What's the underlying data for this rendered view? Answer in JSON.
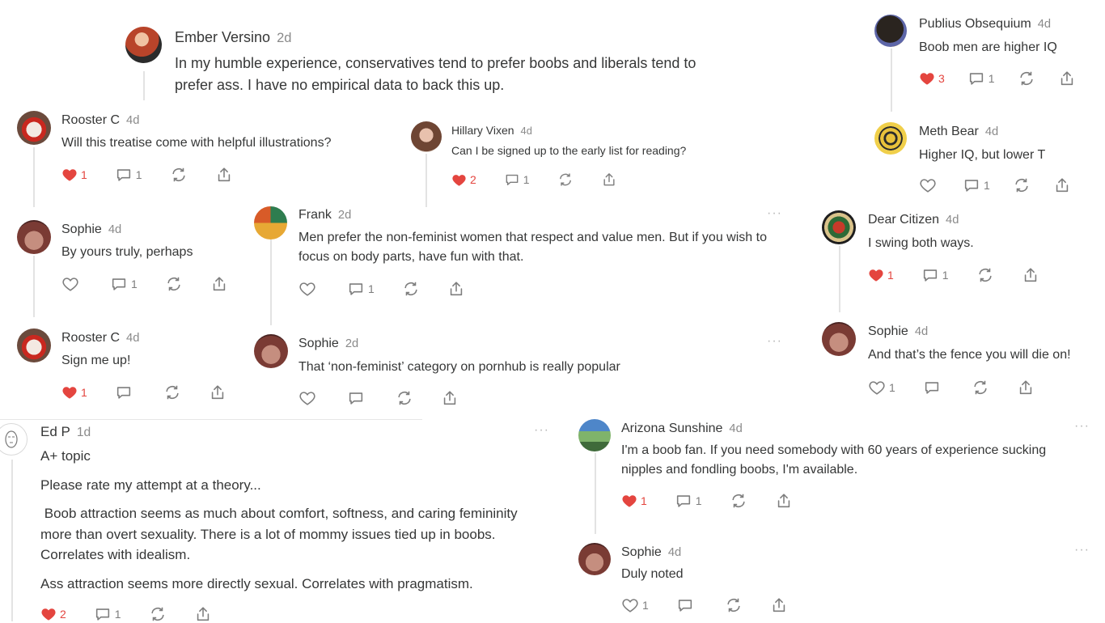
{
  "colors": {
    "liked": "#e4453f",
    "text": "#363737",
    "muted": "#8a8a8a",
    "icon": "#7d7d7d"
  },
  "comments": {
    "ember": {
      "name": "Ember Versino",
      "date": "2d",
      "text": "In my humble experience, conservatives tend to prefer boobs and liberals tend to prefer ass. I have no empirical data to back this up."
    },
    "rooster1": {
      "name": "Rooster C",
      "date": "4d",
      "text": "Will this treatise come with helpful illustrations?",
      "likes": "1",
      "replies": "1",
      "liked": true
    },
    "sophie1": {
      "name": "Sophie",
      "date": "4d",
      "text": "By yours truly, perhaps",
      "likes": "",
      "replies": "1",
      "liked": false
    },
    "rooster2": {
      "name": "Rooster C",
      "date": "4d",
      "text": "Sign me up!",
      "likes": "1",
      "replies": "",
      "liked": true
    },
    "hillary": {
      "name": "Hillary Vixen",
      "date": "4d",
      "text": "Can I be signed up to the early list for reading?",
      "likes": "2",
      "replies": "1",
      "liked": true
    },
    "frank": {
      "name": "Frank",
      "date": "2d",
      "text": "Men prefer the non-feminist women that respect and value men. But if you wish to focus on body parts, have fun with that.",
      "likes": "",
      "replies": "1",
      "liked": false
    },
    "sophie2": {
      "name": "Sophie",
      "date": "2d",
      "text": "That ‘non-feminist’ category on pornhub is really popular",
      "likes": "",
      "replies": "",
      "liked": false
    },
    "publius": {
      "name": "Publius Obsequium",
      "date": "4d",
      "text": "Boob men are higher IQ",
      "likes": "3",
      "replies": "1",
      "liked": true
    },
    "meth": {
      "name": "Meth Bear",
      "date": "4d",
      "text": "Higher IQ, but lower T",
      "likes": "",
      "replies": "1",
      "liked": false
    },
    "dear": {
      "name": "Dear Citizen",
      "date": "4d",
      "text": "I swing both ways.",
      "likes": "1",
      "replies": "1",
      "liked": true
    },
    "sophie3": {
      "name": "Sophie",
      "date": "4d",
      "text": "And that’s the fence you will die on!",
      "likes": "1",
      "replies": "",
      "liked": false
    },
    "edp": {
      "name": "Ed P",
      "date": "1d",
      "paragraphs": [
        "A+ topic",
        "Please rate my attempt at a theory...",
        " Boob attraction seems as much about comfort, softness, and caring femininity more than overt sexuality. There is a lot of mommy issues tied up in boobs. Correlates with idealism.",
        "Ass attraction seems more directly sexual. Correlates with pragmatism."
      ],
      "likes": "2",
      "replies": "1",
      "liked": true
    },
    "arizona": {
      "name": "Arizona Sunshine",
      "date": "4d",
      "text": "I'm a boob fan. If you need somebody with 60 years of experience sucking nipples and fondling boobs, I'm available.",
      "likes": "1",
      "replies": "1",
      "liked": true
    },
    "sophie4": {
      "name": "Sophie",
      "date": "4d",
      "text": "Duly noted",
      "likes": "1",
      "replies": "",
      "liked": false
    }
  },
  "more_label": "···"
}
